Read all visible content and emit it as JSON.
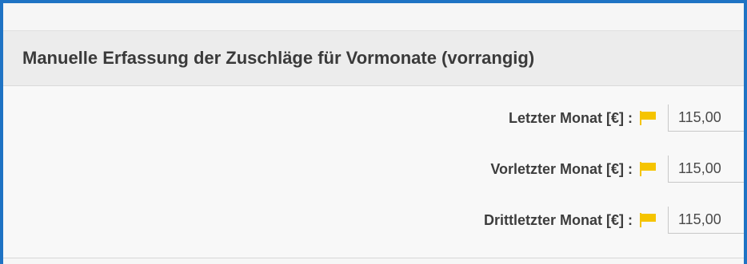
{
  "section": {
    "title": "Manuelle Erfassung der Zuschläge für Vormonate (vorrangig)"
  },
  "rows": [
    {
      "label": "Letzter Monat [€] :",
      "value": "115,00",
      "icon": "flag-icon"
    },
    {
      "label": "Vorletzter Monat [€] :",
      "value": "115,00",
      "icon": "flag-icon"
    },
    {
      "label": "Drittletzter Monat [€] :",
      "value": "115,00",
      "icon": "flag-icon"
    }
  ],
  "colors": {
    "frame_border": "#1f73c4",
    "flag": "#f5c400",
    "header_bg": "#ececec"
  }
}
